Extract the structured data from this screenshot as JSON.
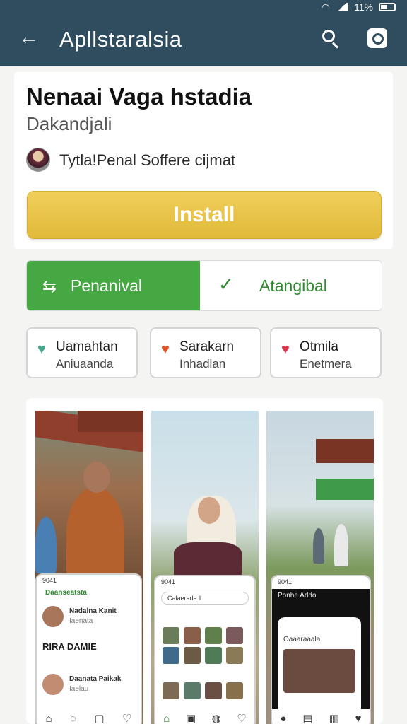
{
  "status_bar": {
    "battery": "11%"
  },
  "app_bar": {
    "title": "Apllstaralsia"
  },
  "app": {
    "title": "Nenaai Vaga hstadia",
    "developer": "Dakandjali",
    "meta": "Tytla!Penal Soffere cijmat",
    "install_label": "Install"
  },
  "segment": {
    "left_label": "Penanival",
    "right_label": "Atangibal"
  },
  "chips": [
    {
      "title": "Uamahtan",
      "sub": "Aniuaanda",
      "color": "#4aa58c"
    },
    {
      "title": "Sarakarn",
      "sub": "Inhadlan",
      "color": "#e0522b"
    },
    {
      "title": "Otmila",
      "sub": "Enetmera",
      "color": "#d9344a"
    }
  ],
  "screens": [
    {
      "time": "9041",
      "header": "Daanseatsta",
      "user1": "Nadalna Kanit",
      "user1_sub": "Iaenata",
      "headline": "RIRA DAMIE",
      "user2": "Daanata Paikak",
      "user2_sub": "Iaelau"
    },
    {
      "time": "9041",
      "search": "Calaerade ll"
    },
    {
      "time": "9041",
      "header": "Ponhe Addo",
      "sub": "Oaaaraaala"
    }
  ]
}
